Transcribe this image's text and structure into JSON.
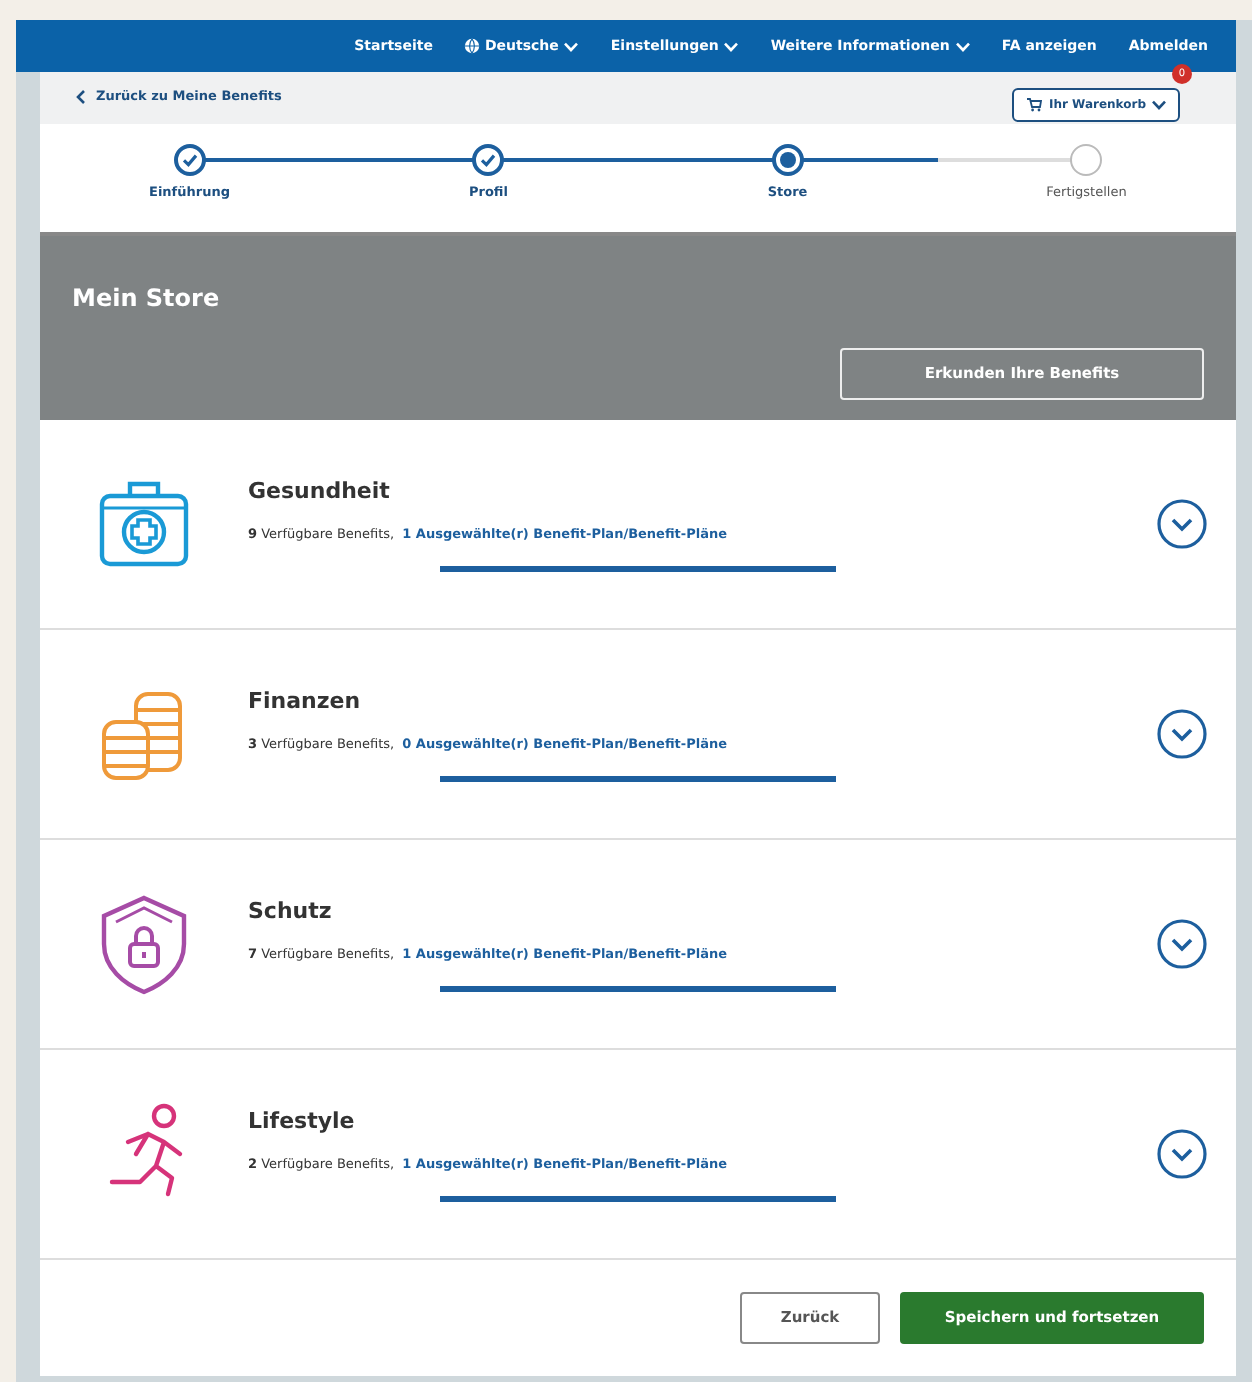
{
  "top_nav": {
    "items": [
      {
        "label": "Startseite",
        "kind": "link"
      },
      {
        "label": "Deutsche",
        "kind": "language"
      },
      {
        "label": "Einstellungen",
        "kind": "dropdown"
      },
      {
        "label": "Weitere Informationen",
        "kind": "dropdown"
      },
      {
        "label": "FA anzeigen",
        "kind": "link"
      },
      {
        "label": "Abmelden",
        "kind": "link"
      }
    ]
  },
  "back_link": "Zurück zu Meine Benefits",
  "cart": {
    "label": "Ihr Warenkorb",
    "badge": "0"
  },
  "steps": [
    {
      "label": "Einführung",
      "completed": true,
      "selected": false
    },
    {
      "label": "Profil",
      "completed": true,
      "selected": false
    },
    {
      "label": "Store",
      "completed": false,
      "selected": true
    },
    {
      "label": "Fertigstellen",
      "completed": false,
      "selected": false
    }
  ],
  "header": {
    "title": "Mein Store",
    "button": "Erkunden Ihre Benefits"
  },
  "categories": [
    {
      "kind": "health",
      "name": "Gesundheit",
      "available": "**9** Verfügbare Benefits,",
      "selected_link": "1 Ausgewählte(r) Benefit-Plan/Benefit-Pläne",
      "expanded": false
    },
    {
      "kind": "finance",
      "name": "Finanzen",
      "available": "**3** Verfügbare Benefits,",
      "selected_link": "0 Ausgewählte(r) Benefit-Plan/Benefit-Pläne",
      "expanded": false
    },
    {
      "kind": "protection",
      "name": "Schutz",
      "available": "**7** Verfügbare Benefits,",
      "selected_link": "1 Ausgewählte(r) Benefit-Plan/Benefit-Pläne",
      "expanded": false
    },
    {
      "kind": "lifestyle",
      "name": "Lifestyle",
      "available": "**2** Verfügbare Benefits,",
      "selected_link": "1 Ausgewählte(r) Benefit-Plan/Benefit-Pläne",
      "expanded": false
    }
  ],
  "footer": {
    "back_button": "Zurück",
    "save_button": "Speichern und fortsetzen"
  }
}
